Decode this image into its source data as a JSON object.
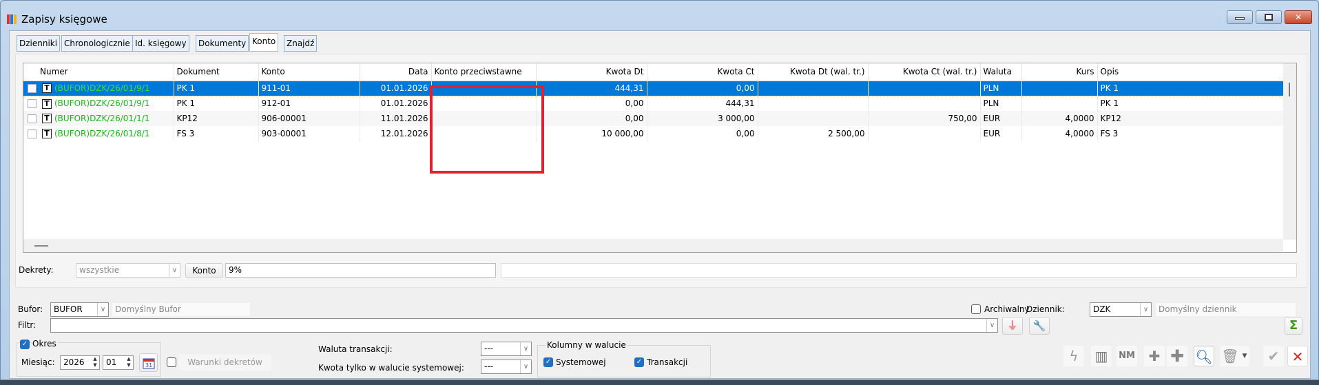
{
  "window": {
    "title": "Zapisy księgowe"
  },
  "tabs": [
    {
      "label": "Dzienniki"
    },
    {
      "label": "Chronologicznie"
    },
    {
      "label": "Id. księgowy"
    },
    {
      "label": "Dokumenty"
    },
    {
      "label": "Konto",
      "active": true
    },
    {
      "label": "Znajdź"
    }
  ],
  "grid": {
    "columns": [
      "Numer",
      "Dokument",
      "Konto",
      "Data",
      "Konto przeciwstawne",
      "Kwota Dt",
      "Kwota Ct",
      "Kwota Dt (wal. tr.)",
      "Kwota Ct (wal. tr.)",
      "Waluta",
      "Kurs",
      "Opis"
    ],
    "rows": [
      {
        "numer": "(BUFOR)DZK/26/01/9/1",
        "dokument": "PK 1",
        "konto": "911-01",
        "data": "01.01.2026",
        "konto_przeciwstawne": "",
        "kwota_dt": "444,31",
        "kwota_ct": "0,00",
        "kwota_dt_wal": "",
        "kwota_ct_wal": "",
        "waluta": "PLN",
        "kurs": "",
        "opis": "PK 1",
        "selected": true
      },
      {
        "numer": "(BUFOR)DZK/26/01/9/1",
        "dokument": "PK 1",
        "konto": "912-01",
        "data": "01.01.2026",
        "konto_przeciwstawne": "",
        "kwota_dt": "0,00",
        "kwota_ct": "444,31",
        "kwota_dt_wal": "",
        "kwota_ct_wal": "",
        "waluta": "PLN",
        "kurs": "",
        "opis": "PK 1"
      },
      {
        "numer": "(BUFOR)DZK/26/01/1/1",
        "dokument": "KP12",
        "konto": "906-00001",
        "data": "11.01.2026",
        "konto_przeciwstawne": "",
        "kwota_dt": "0,00",
        "kwota_ct": "3 000,00",
        "kwota_dt_wal": "",
        "kwota_ct_wal": "750,00",
        "waluta": "EUR",
        "kurs": "4,0000",
        "opis": "KP12"
      },
      {
        "numer": "(BUFOR)DZK/26/01/8/1",
        "dokument": "FS 3",
        "konto": "903-00001",
        "data": "12.01.2026",
        "konto_przeciwstawne": "",
        "kwota_dt": "10 000,00",
        "kwota_ct": "0,00",
        "kwota_dt_wal": "2 500,00",
        "kwota_ct_wal": "",
        "waluta": "EUR",
        "kurs": "4,0000",
        "opis": "FS 3"
      }
    ]
  },
  "dekrety": {
    "label": "Dekrety:",
    "value": "wszystkie",
    "konto_button": "Konto",
    "konto_value": "9%",
    "extra_value": ""
  },
  "bufor": {
    "label": "Bufor:",
    "value": "BUFOR",
    "description": "Domyślny Bufor"
  },
  "archiwalny": {
    "label": "Archiwalny",
    "checked": false
  },
  "dziennik": {
    "label": "Dziennik:",
    "value": "DZK",
    "description": "Domyślny dziennik"
  },
  "filtr": {
    "label": "Filtr:",
    "value": ""
  },
  "okres": {
    "label": "Okres",
    "checked": true,
    "miesiac_label": "Miesiąc:",
    "year": "2026",
    "month": "01"
  },
  "warunki": {
    "label": "Warunki dekretów",
    "checked": false
  },
  "waluta": {
    "transakcji_label": "Waluta transakcji:",
    "transakcji_value": "---",
    "kwota_label": "Kwota tylko w walucie systemowej:",
    "kwota_value": "---"
  },
  "kolumny": {
    "label": "Kolumny w walucie",
    "systemowej": "Systemowej",
    "transakcji": "Transakcji"
  },
  "colors": {
    "accent": "#0078d7",
    "numer_text": "#1cb51c",
    "highlight": "#e5202e"
  }
}
